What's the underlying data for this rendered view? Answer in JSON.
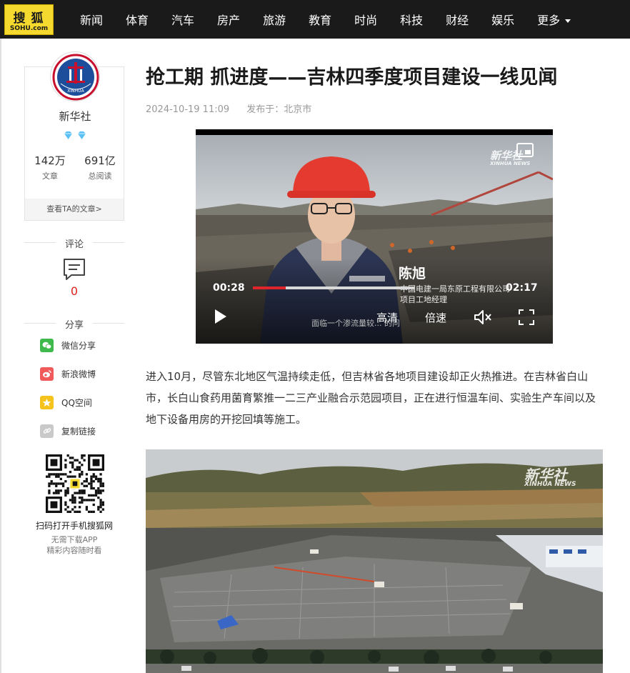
{
  "header": {
    "logo_top": "搜狐",
    "logo_bottom": "SOHU.com",
    "nav": [
      "新闻",
      "体育",
      "汽车",
      "房产",
      "旅游",
      "教育",
      "时尚",
      "科技",
      "财经",
      "娱乐"
    ],
    "more_label": "更多"
  },
  "author": {
    "name": "新华社",
    "articles_count": "142万",
    "articles_label": "文章",
    "reads_count": "691亿",
    "reads_label": "总阅读",
    "link": "查看TA的文章>",
    "avatar_text": "XINHUA"
  },
  "comments": {
    "title": "评论",
    "count": "0"
  },
  "share": {
    "title": "分享",
    "items": [
      {
        "label": "微信分享",
        "color": "#3fb94b"
      },
      {
        "label": "新浪微博",
        "color": "#f05a5a"
      },
      {
        "label": "QQ空间",
        "color": "#f5c31c"
      },
      {
        "label": "复制链接",
        "color": "#c9c9c9"
      }
    ]
  },
  "qr": {
    "caption": "扫码打开手机搜狐网",
    "sub1": "无需下载APP",
    "sub2": "精彩内容随时看"
  },
  "article": {
    "title": "抢工期 抓进度——吉林四季度项目建设一线见闻",
    "date": "2024-10-19 11:09",
    "location": "发布于：北京市",
    "paragraph": "进入10月，尽管东北地区气温持续走低，但吉林省各地项目建设却正火热推进。在吉林省白山市，长白山食药用菌育繁推一二三产业融合示范园项目，正在进行恒温车间、实验生产车间以及地下设备用房的开挖回填等施工。"
  },
  "video": {
    "current_time": "00:28",
    "duration": "02:17",
    "progress": 0.204,
    "quality_label": "高清",
    "speed_label": "倍速",
    "person_name": "陈旭",
    "person_title_1": "中国电建一局东原工程有限公司",
    "person_title_2": "项目工地经理",
    "subtitle": "面临一个渗流量较... 的问",
    "watermark": "新华社",
    "watermark_en": "XINHUA NEWS"
  },
  "photo": {
    "watermark": "新华社",
    "watermark_en": "XINHUA NEWS"
  },
  "colors": {
    "topbar": "#1a1a1a",
    "logo_bg": "#f6d92f",
    "accent_red": "#e0242b"
  }
}
